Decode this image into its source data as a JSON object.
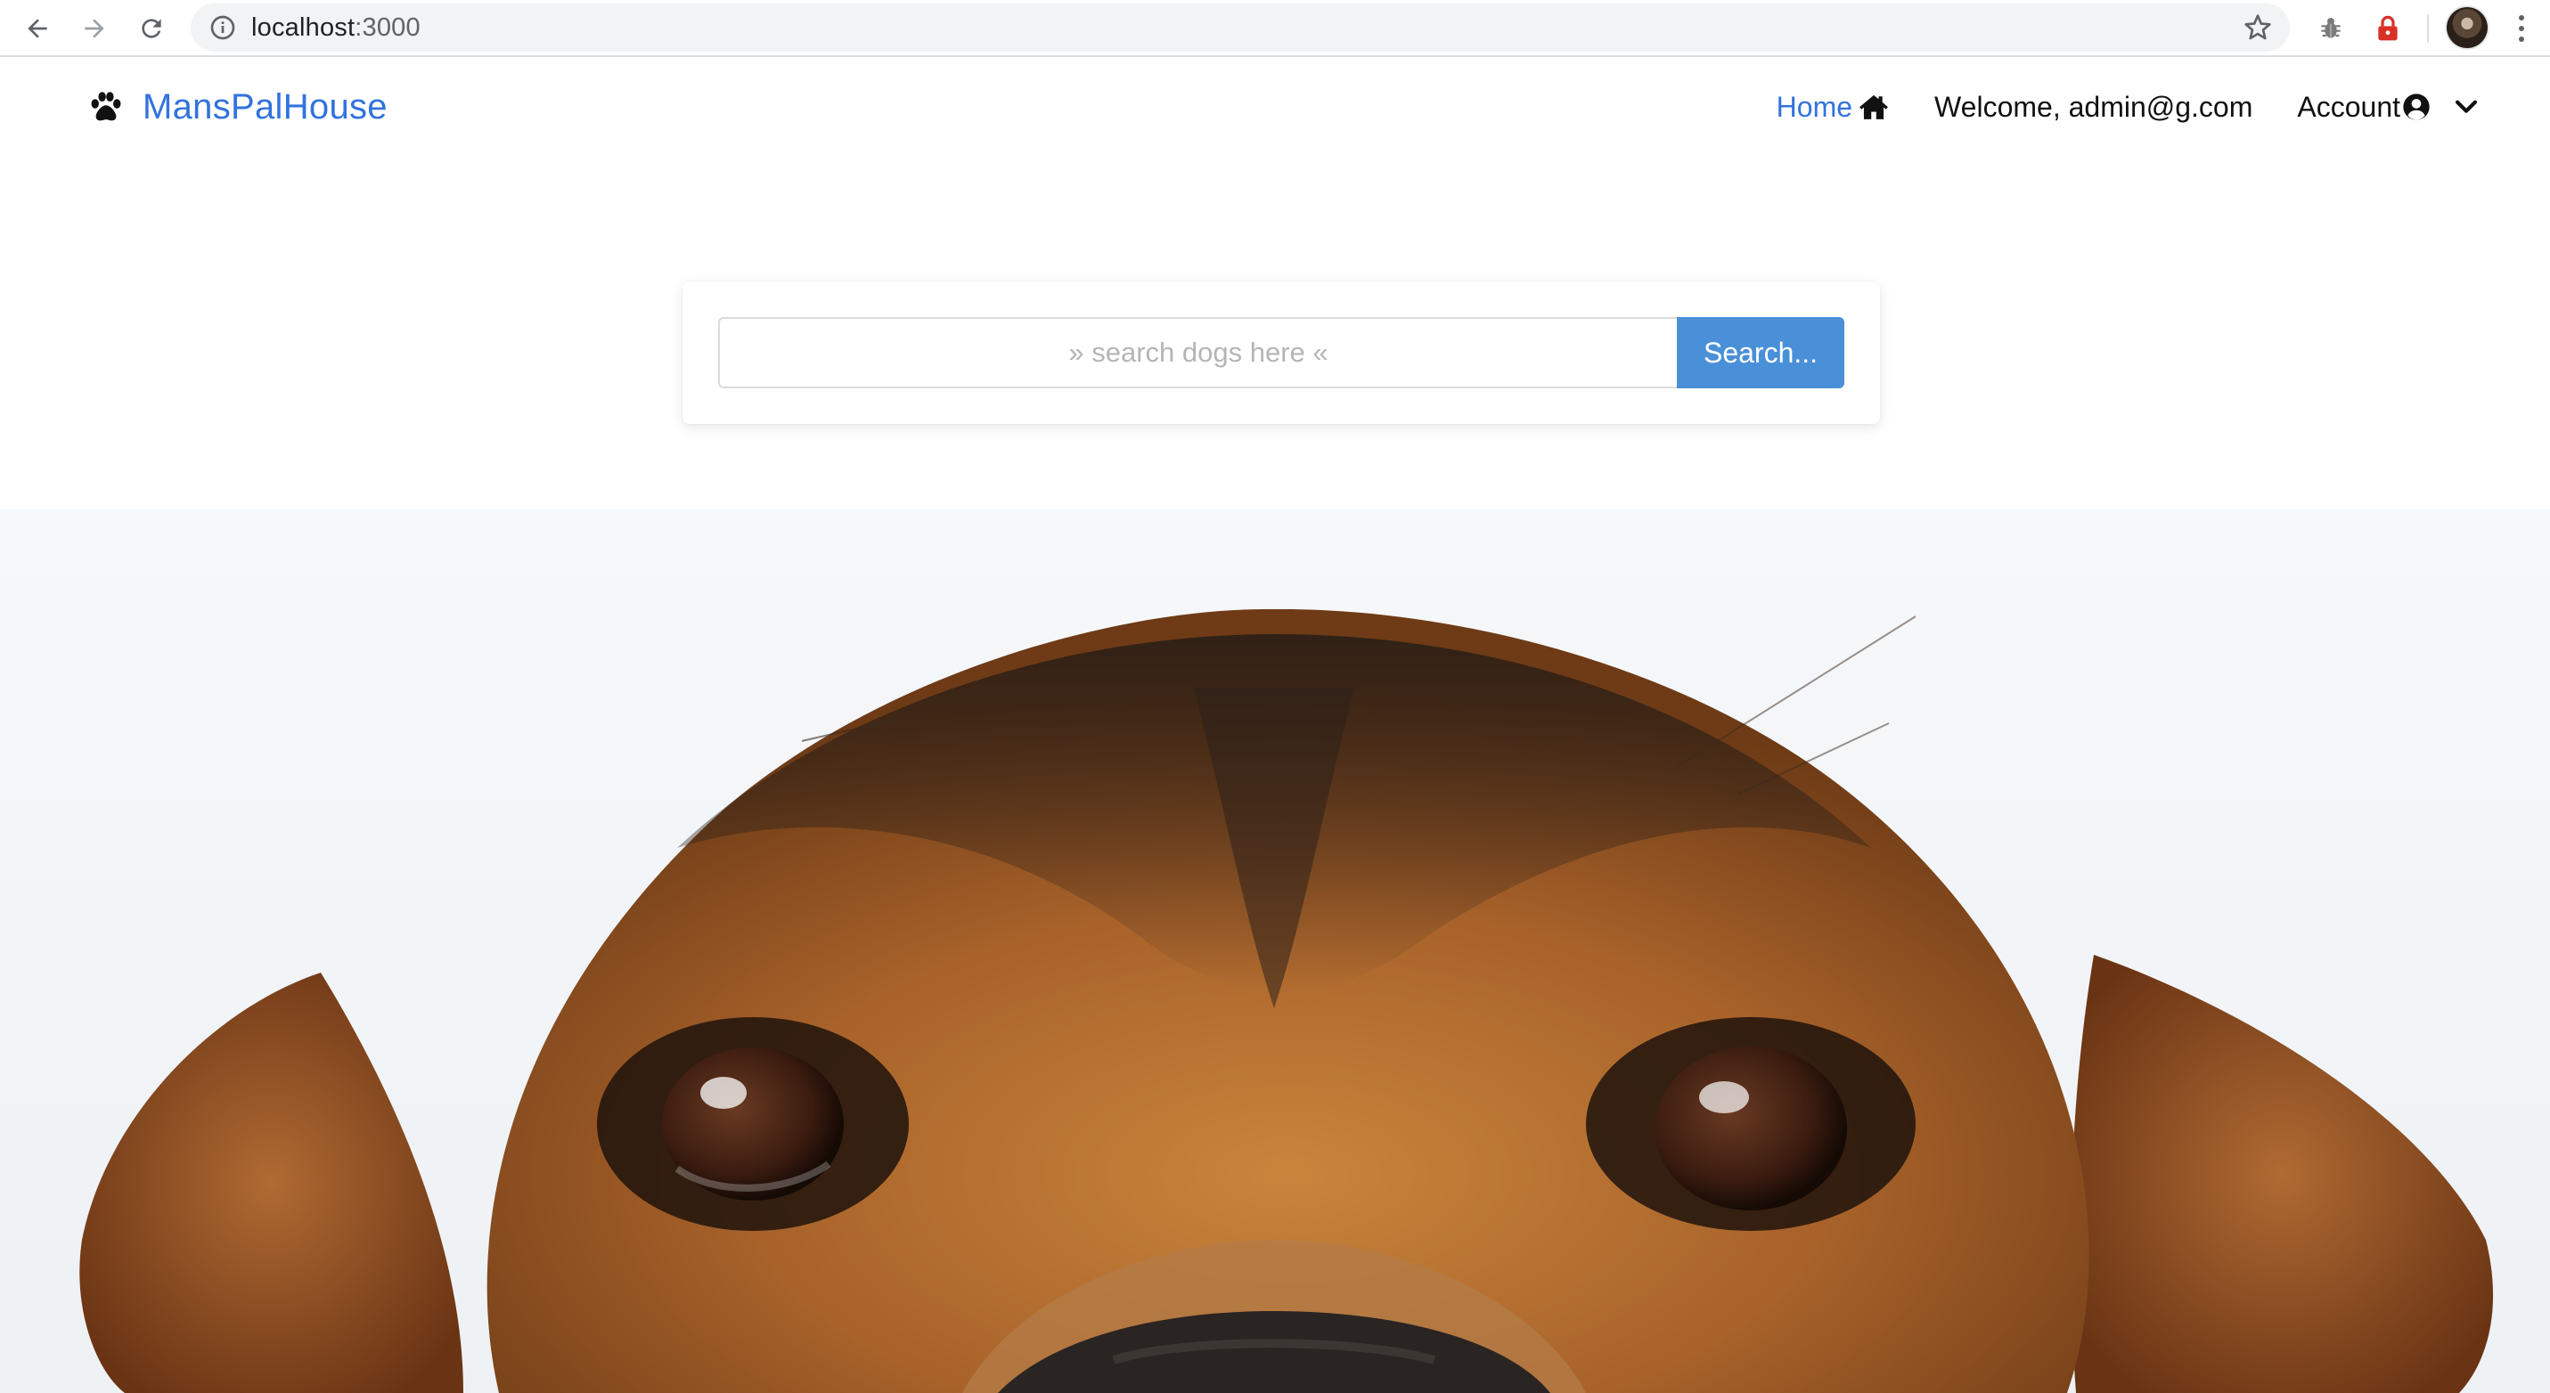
{
  "browser": {
    "url_host": "localhost",
    "url_port": ":3000",
    "icons": [
      "back-arrow-icon",
      "forward-arrow-icon",
      "reload-icon",
      "info-icon",
      "star-icon",
      "bug-extension-icon",
      "lock-extension-icon",
      "profile-avatar",
      "more-vert-icon"
    ]
  },
  "navbar": {
    "brand": "MansPalHouse",
    "home_label": "Home",
    "welcome_text": "Welcome, admin@g.com",
    "account_label": "Account"
  },
  "search": {
    "placeholder": "» search dogs here «",
    "value": "",
    "button_label": "Search..."
  },
  "colors": {
    "brand": "#3273dc",
    "search_button": "#4a90d9"
  },
  "hero": {
    "subject": "dog-face-photo"
  }
}
